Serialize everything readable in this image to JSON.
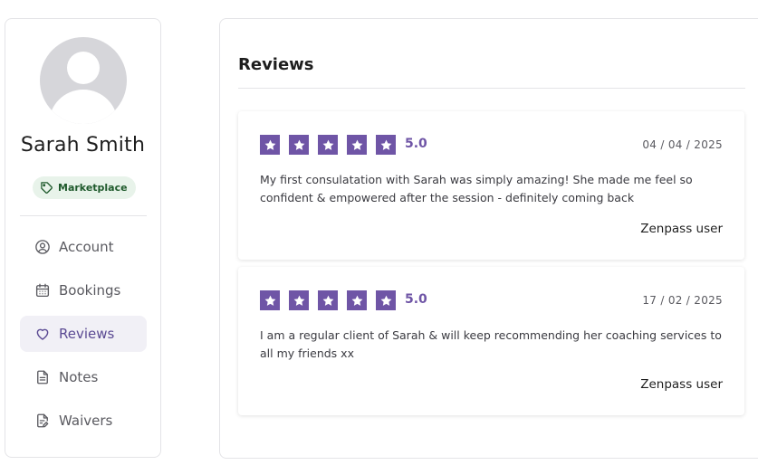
{
  "profile": {
    "name": "Sarah Smith",
    "tag": "Marketplace",
    "avatar_icon": "user-avatar-placeholder"
  },
  "sidebar": {
    "items": [
      {
        "label": "Account",
        "icon": "user-circle-icon",
        "active": false
      },
      {
        "label": "Bookings",
        "icon": "calendar-icon",
        "active": false
      },
      {
        "label": "Reviews",
        "icon": "heart-icon",
        "active": true
      },
      {
        "label": "Notes",
        "icon": "document-icon",
        "active": false
      },
      {
        "label": "Waivers",
        "icon": "document-edit-icon",
        "active": false
      }
    ]
  },
  "main": {
    "title": "Reviews",
    "reviews": [
      {
        "stars": 5,
        "rating": "5.0",
        "date": "04 / 04 / 2025",
        "text": "My first consulatation with Sarah was simply amazing! She made me feel so confident & empowered after the session - definitely coming back",
        "author": "Zenpass user"
      },
      {
        "stars": 5,
        "rating": "5.0",
        "date": "17 / 02 / 2025",
        "text": "I am a regular client of Sarah & will keep recommending her coaching services to all my friends xx",
        "author": "Zenpass user"
      }
    ]
  },
  "colors": {
    "accent": "#6f55a6",
    "tag_bg": "#e8f3ea",
    "tag_text": "#1f5a2c",
    "active_bg": "#f1f0f6"
  }
}
